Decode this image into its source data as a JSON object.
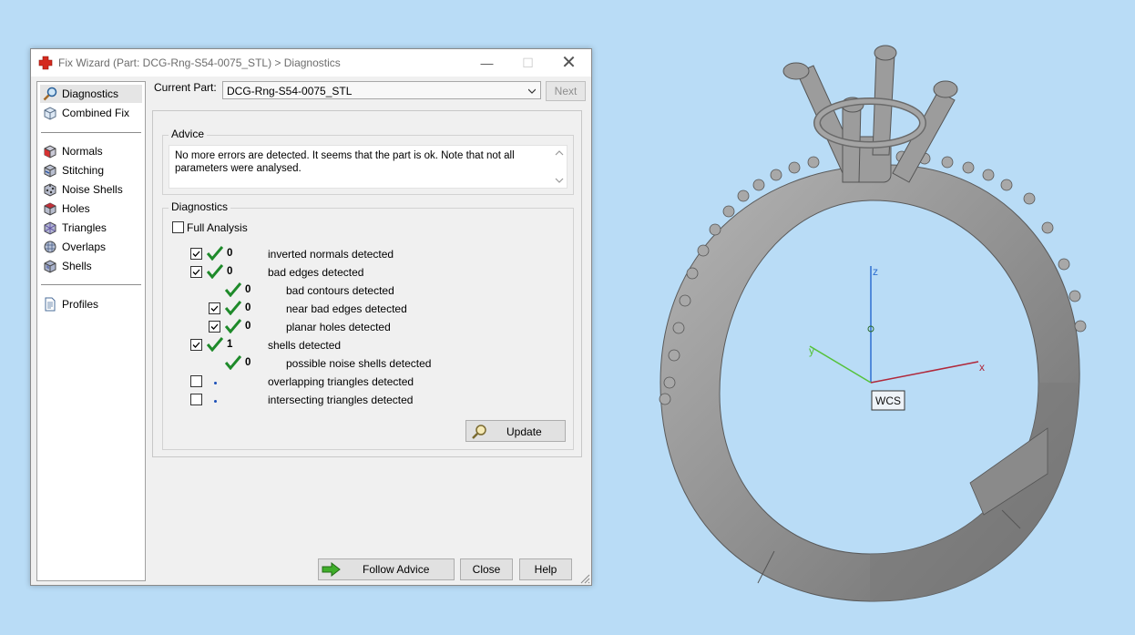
{
  "window": {
    "title": "Fix Wizard (Part: DCG-Rng-S54-0075_STL) > Diagnostics",
    "minimize_glyph": "—",
    "maximize_glyph": "☐",
    "close_glyph": "✕"
  },
  "nav": {
    "items": [
      {
        "label": "Diagnostics",
        "icon": "magnifier-icon"
      },
      {
        "label": "Combined Fix",
        "icon": "cube-outline-icon"
      },
      {
        "label": "Normals",
        "icon": "normals-cube-icon"
      },
      {
        "label": "Stitching",
        "icon": "stitching-cube-icon"
      },
      {
        "label": "Noise Shells",
        "icon": "noise-shells-icon"
      },
      {
        "label": "Holes",
        "icon": "holes-cube-icon"
      },
      {
        "label": "Triangles",
        "icon": "triangles-icon"
      },
      {
        "label": "Overlaps",
        "icon": "overlaps-icon"
      },
      {
        "label": "Shells",
        "icon": "shells-icon"
      },
      {
        "label": "Profiles",
        "icon": "document-icon"
      }
    ]
  },
  "header": {
    "current_part_label": "Current Part:",
    "current_part_value": "DCG-Rng-S54-0075_STL",
    "next_label": "Next"
  },
  "advice": {
    "title": "Advice",
    "text": "No more errors are detected. It seems that the part is ok. Note that not all parameters were analysed."
  },
  "diagnostics": {
    "title": "Diagnostics",
    "full_analysis_label": "Full Analysis",
    "full_analysis_checked": false,
    "rows": [
      {
        "checkbox": true,
        "checked": true,
        "status": "ok",
        "count": "0",
        "label": "inverted normals detected",
        "indent": 0
      },
      {
        "checkbox": true,
        "checked": true,
        "status": "ok",
        "count": "0",
        "label": "bad edges detected",
        "indent": 0
      },
      {
        "checkbox": false,
        "checked": false,
        "status": "ok",
        "count": "0",
        "label": "bad contours detected",
        "indent": 1
      },
      {
        "checkbox": true,
        "checked": true,
        "status": "ok",
        "count": "0",
        "label": "near bad edges detected",
        "indent": 1
      },
      {
        "checkbox": true,
        "checked": true,
        "status": "ok",
        "count": "0",
        "label": "planar holes detected",
        "indent": 1
      },
      {
        "checkbox": true,
        "checked": true,
        "status": "ok",
        "count": "1",
        "label": "shells detected",
        "indent": 0
      },
      {
        "checkbox": false,
        "checked": false,
        "status": "ok",
        "count": "0",
        "label": "possible noise shells detected",
        "indent": 1
      },
      {
        "checkbox": true,
        "checked": false,
        "status": "pending",
        "count": "",
        "label": "overlapping triangles detected",
        "indent": 0
      },
      {
        "checkbox": true,
        "checked": false,
        "status": "pending",
        "count": "",
        "label": "intersecting triangles detected",
        "indent": 0
      }
    ],
    "update_label": "Update"
  },
  "footer": {
    "follow_advice_label": "Follow Advice",
    "close_label": "Close",
    "help_label": "Help"
  },
  "viewport": {
    "axis_z_label": "z",
    "axis_y_label": "y",
    "axis_x_label": "x",
    "wcs_label": "WCS"
  },
  "colors": {
    "background": "#b9dcf6",
    "check_green": "#1e8a2a",
    "axis_z": "#2e6fd1",
    "axis_y": "#55c23a",
    "axis_x": "#b0283a",
    "model_gray": "#9a9a9a"
  }
}
